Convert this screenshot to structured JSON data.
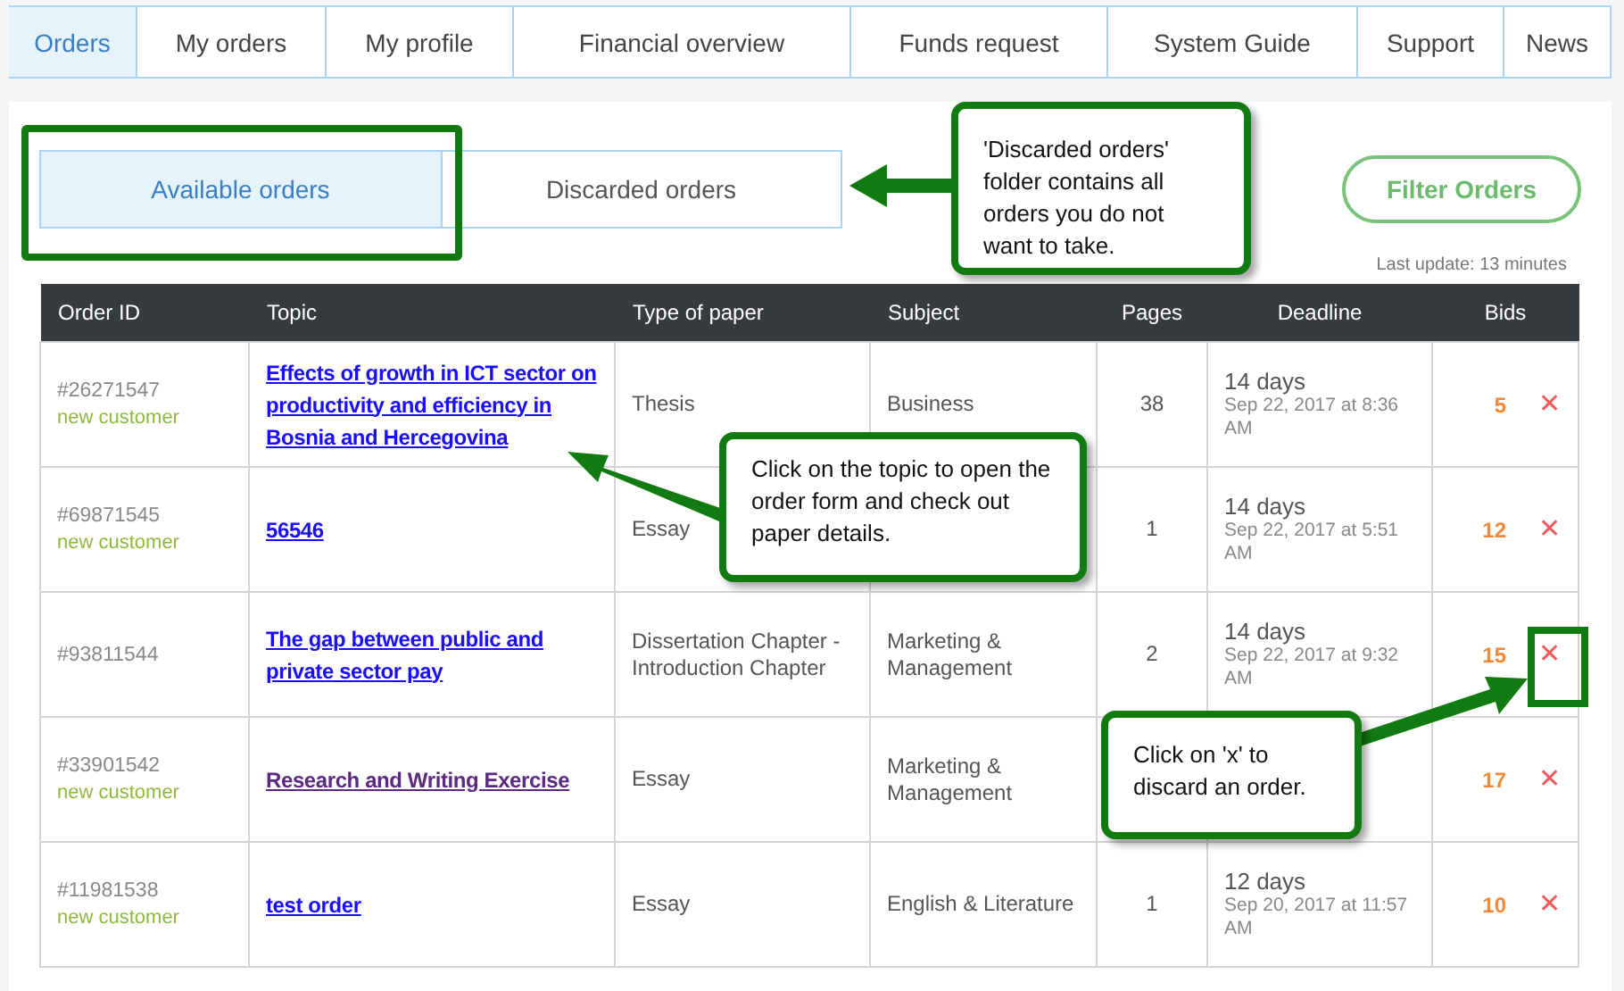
{
  "nav": {
    "tabs": [
      {
        "label": "Orders",
        "selected": true
      },
      {
        "label": "My orders",
        "selected": false
      },
      {
        "label": "My profile",
        "selected": false
      },
      {
        "label": "Financial overview",
        "selected": false
      },
      {
        "label": "Funds request",
        "selected": false
      },
      {
        "label": "System Guide",
        "selected": false
      },
      {
        "label": "Support",
        "selected": false
      },
      {
        "label": "News",
        "selected": false
      }
    ]
  },
  "folders": [
    {
      "label": "Available orders",
      "selected": true
    },
    {
      "label": "Discarded orders",
      "selected": false
    }
  ],
  "filter_button": "Filter Orders",
  "last_update": "Last update: 13 minutes",
  "table": {
    "columns": [
      "Order ID",
      "Topic",
      "Type of paper",
      "Subject",
      "Pages",
      "Deadline",
      "Bids"
    ],
    "rows": [
      {
        "id": "#26271547",
        "tag": "new customer",
        "topic": "Effects of growth in ICT sector on productivity and efficiency in Bosnia and Hercegovina",
        "visited": false,
        "type": "Thesis",
        "subject": "Business",
        "pages": "38",
        "days": "14 days",
        "date": "Sep 22, 2017 at 8:36 AM",
        "bids": "5",
        "discard": "✕"
      },
      {
        "id": "#69871545",
        "tag": "new customer",
        "topic": "56546",
        "visited": false,
        "type": "Essay",
        "pages": "1",
        "days": "14 days",
        "date": "Sep 22, 2017 at 5:51 AM",
        "bids": "12",
        "discard": "✕"
      },
      {
        "id": "#93811544",
        "topic": "The gap between public and private sector pay",
        "visited": false,
        "type": "Dissertation Chapter - Introduction Chapter",
        "subject": "Marketing & Management",
        "pages": "2",
        "days": "14 days",
        "date": "Sep 22, 2017 at 9:32 AM",
        "bids": "15",
        "discard": "✕"
      },
      {
        "id": "#33901542",
        "tag": "new customer",
        "topic": "Research and Writing Exercise",
        "visited": true,
        "type": "Essay",
        "subject": "Marketing & Management",
        "bids": "17",
        "discard": "✕"
      },
      {
        "id": "#11981538",
        "tag": "new customer",
        "topic": "test order",
        "visited": false,
        "type": "Essay",
        "subject": "English & Literature",
        "pages": "1",
        "days": "12 days",
        "date": "Sep 20, 2017 at 11:57 AM",
        "bids": "10",
        "discard": "✕"
      }
    ]
  },
  "callouts": [
    "'Discarded orders' folder contains all orders you do not want to take.",
    "Click on the topic to open the order form and check out paper details.",
    "Click on 'x' to discard an order."
  ]
}
